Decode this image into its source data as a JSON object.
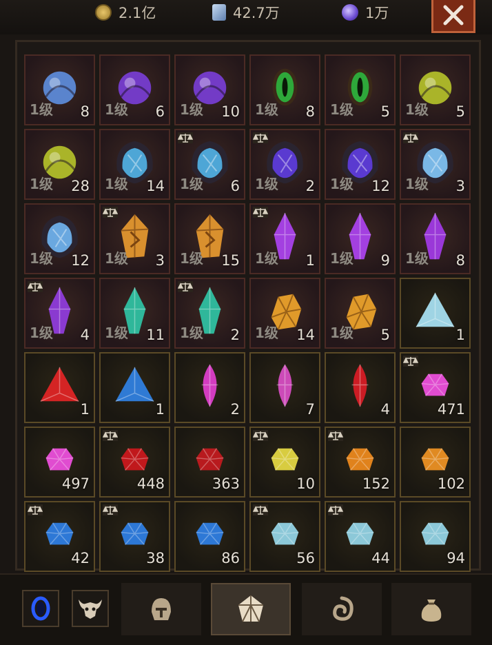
{
  "currencies": [
    {
      "icon": "gold-coin-icon",
      "value": "2.1亿",
      "color": "#c9a24a"
    },
    {
      "icon": "crystal-shard-icon",
      "value": "42.7万",
      "color": "#8fb0d6"
    },
    {
      "icon": "purple-orb-icon",
      "value": "1万",
      "color": "#8866dd"
    }
  ],
  "items": [
    {
      "icon": "blue-spirit-gem-icon",
      "color": "#5e8fe0",
      "quality": "rare",
      "shape": "orb",
      "level": "1级",
      "qty": "8",
      "locked": false
    },
    {
      "icon": "purple-smoke-gem-icon",
      "color": "#7a3ed8",
      "quality": "rare",
      "shape": "orb",
      "level": "1级",
      "qty": "6",
      "locked": false
    },
    {
      "icon": "purple-smoke-gem-icon",
      "color": "#7a3ed8",
      "quality": "rare",
      "shape": "orb",
      "level": "1级",
      "qty": "10",
      "locked": false
    },
    {
      "icon": "green-eye-gem-icon",
      "color": "#2ea83a",
      "quality": "rare",
      "shape": "eye",
      "level": "1级",
      "qty": "8",
      "locked": false
    },
    {
      "icon": "green-eye-gem-icon",
      "color": "#2ea83a",
      "quality": "rare",
      "shape": "eye",
      "level": "1级",
      "qty": "5",
      "locked": false
    },
    {
      "icon": "yellow-glow-gem-icon",
      "color": "#b7c42a",
      "quality": "rare",
      "shape": "orb",
      "level": "1级",
      "qty": "5",
      "locked": false
    },
    {
      "icon": "yellow-glow-gem-icon",
      "color": "#b7c42a",
      "quality": "rare",
      "shape": "orb",
      "level": "1级",
      "qty": "28",
      "locked": false
    },
    {
      "icon": "blue-claw-gem-icon",
      "color": "#4ea6d6",
      "quality": "rare",
      "shape": "claw",
      "level": "1级",
      "qty": "14",
      "locked": false
    },
    {
      "icon": "blue-claw-gem-icon",
      "color": "#4ea6d6",
      "quality": "rare",
      "shape": "claw",
      "level": "1级",
      "qty": "6",
      "locked": true
    },
    {
      "icon": "purple-claw-gem-icon",
      "color": "#5a3ad0",
      "quality": "rare",
      "shape": "claw",
      "level": "1级",
      "qty": "2",
      "locked": true
    },
    {
      "icon": "purple-claw-gem-icon",
      "color": "#5a3ad0",
      "quality": "rare",
      "shape": "claw",
      "level": "1级",
      "qty": "12",
      "locked": false
    },
    {
      "icon": "ice-claw-gem-icon",
      "color": "#7ab8e6",
      "quality": "rare",
      "shape": "claw",
      "level": "1级",
      "qty": "3",
      "locked": true
    },
    {
      "icon": "ice-claw-gem-icon",
      "color": "#6aa8e0",
      "quality": "rare",
      "shape": "claw",
      "level": "1级",
      "qty": "12",
      "locked": false
    },
    {
      "icon": "amber-rune-gem-icon",
      "color": "#d9902e",
      "quality": "rare",
      "shape": "rune",
      "level": "1级",
      "qty": "3",
      "locked": true
    },
    {
      "icon": "amber-rune-gem-icon",
      "color": "#d9902e",
      "quality": "rare",
      "shape": "rune",
      "level": "1级",
      "qty": "15",
      "locked": false
    },
    {
      "icon": "violet-shard-gem-icon",
      "color": "#a340e0",
      "quality": "rare",
      "shape": "shard",
      "level": "1级",
      "qty": "1",
      "locked": true
    },
    {
      "icon": "violet-shard-gem-icon",
      "color": "#a340e0",
      "quality": "rare",
      "shape": "shard",
      "level": "1级",
      "qty": "9",
      "locked": false
    },
    {
      "icon": "violet-shard-gem-icon",
      "color": "#9a38d8",
      "quality": "rare",
      "shape": "shard",
      "level": "1级",
      "qty": "8",
      "locked": false
    },
    {
      "icon": "violet-shard-gem-icon",
      "color": "#8a3ad0",
      "quality": "rare",
      "shape": "shard",
      "level": "1级",
      "qty": "4",
      "locked": true
    },
    {
      "icon": "teal-shard-gem-icon",
      "color": "#2fb79a",
      "quality": "rare",
      "shape": "shard",
      "level": "1级",
      "qty": "11",
      "locked": false
    },
    {
      "icon": "teal-shard-gem-icon",
      "color": "#2fb79a",
      "quality": "rare",
      "shape": "shard",
      "level": "1级",
      "qty": "2",
      "locked": true
    },
    {
      "icon": "amber-cluster-gem-icon",
      "color": "#e09a2a",
      "quality": "rare",
      "shape": "cluster",
      "level": "1级",
      "qty": "14",
      "locked": false
    },
    {
      "icon": "amber-cluster-gem-icon",
      "color": "#e09a2a",
      "quality": "rare",
      "shape": "cluster",
      "level": "1级",
      "qty": "5",
      "locked": false
    },
    {
      "icon": "pale-triangle-gem-icon",
      "color": "#9fd4e4",
      "quality": "gold",
      "shape": "triangle",
      "level": "",
      "qty": "1",
      "locked": false
    },
    {
      "icon": "red-triangle-gem-icon",
      "color": "#d42424",
      "quality": "gold",
      "shape": "triangle",
      "level": "",
      "qty": "1",
      "locked": false
    },
    {
      "icon": "blue-triangle-gem-icon",
      "color": "#2f7ad4",
      "quality": "gold",
      "shape": "triangle",
      "level": "",
      "qty": "1",
      "locked": false
    },
    {
      "icon": "pink-marquise-gem-icon",
      "color": "#d23cc0",
      "quality": "gold",
      "shape": "marquise",
      "level": "",
      "qty": "2",
      "locked": false
    },
    {
      "icon": "pink-marquise-gem-icon",
      "color": "#cc4ab8",
      "quality": "gold",
      "shape": "marquise",
      "level": "",
      "qty": "7",
      "locked": false
    },
    {
      "icon": "red-marquise-gem-icon",
      "color": "#cc1c24",
      "quality": "gold",
      "shape": "marquise",
      "level": "",
      "qty": "4",
      "locked": false
    },
    {
      "icon": "pink-round-gem-icon",
      "color": "#e04cd0",
      "quality": "gold",
      "shape": "round",
      "level": "",
      "qty": "471",
      "locked": true
    },
    {
      "icon": "pink-round-gem-icon",
      "color": "#e04cd0",
      "quality": "gold",
      "shape": "round",
      "level": "",
      "qty": "497",
      "locked": false
    },
    {
      "icon": "red-round-gem-icon",
      "color": "#c0181c",
      "quality": "gold",
      "shape": "round",
      "level": "",
      "qty": "448",
      "locked": true
    },
    {
      "icon": "red-round-gem-icon",
      "color": "#b81a1e",
      "quality": "gold",
      "shape": "round",
      "level": "",
      "qty": "363",
      "locked": false
    },
    {
      "icon": "yellow-round-gem-icon",
      "color": "#d8cc40",
      "quality": "gold",
      "shape": "round",
      "level": "",
      "qty": "10",
      "locked": true
    },
    {
      "icon": "orange-round-gem-icon",
      "color": "#e0821c",
      "quality": "gold",
      "shape": "round",
      "level": "",
      "qty": "152",
      "locked": true
    },
    {
      "icon": "orange-round-gem-icon",
      "color": "#e08a22",
      "quality": "gold",
      "shape": "round",
      "level": "",
      "qty": "102",
      "locked": false
    },
    {
      "icon": "blue-round-gem-icon",
      "color": "#2d78d6",
      "quality": "gold",
      "shape": "round",
      "level": "",
      "qty": "42",
      "locked": true
    },
    {
      "icon": "blue-round-gem-icon",
      "color": "#2d78d6",
      "quality": "gold",
      "shape": "round",
      "level": "",
      "qty": "38",
      "locked": true
    },
    {
      "icon": "blue-round-gem-icon",
      "color": "#2d78d6",
      "quality": "gold",
      "shape": "round",
      "level": "",
      "qty": "86",
      "locked": false
    },
    {
      "icon": "cyan-round-gem-icon",
      "color": "#8cc8d8",
      "quality": "gold",
      "shape": "round",
      "level": "",
      "qty": "56",
      "locked": true
    },
    {
      "icon": "cyan-round-gem-icon",
      "color": "#8cc8d8",
      "quality": "gold",
      "shape": "round",
      "level": "",
      "qty": "44",
      "locked": true
    },
    {
      "icon": "cyan-round-gem-icon",
      "color": "#8cc8d8",
      "quality": "gold",
      "shape": "round",
      "level": "",
      "qty": "94",
      "locked": false
    }
  ],
  "bottom_bar": {
    "slots": [
      {
        "icon": "blue-portal-icon"
      },
      {
        "icon": "bull-skull-icon"
      }
    ],
    "tabs": [
      {
        "icon": "helmet-icon",
        "active": false
      },
      {
        "icon": "gem-tab-icon",
        "active": true
      },
      {
        "icon": "rune-swirl-icon",
        "active": false
      },
      {
        "icon": "loot-bag-icon",
        "active": false
      }
    ]
  }
}
